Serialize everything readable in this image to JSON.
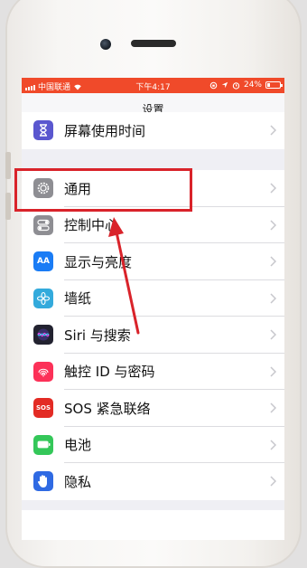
{
  "status_bar": {
    "carrier": "中国联通",
    "time": "下午4:17",
    "battery": "24%",
    "battery_fraction": 0.24
  },
  "navbar": {
    "title": "设置"
  },
  "settings": {
    "top_item": {
      "label": "屏幕使用时间",
      "icon": "hourglass-icon",
      "color": "#5a57cf"
    },
    "items": [
      {
        "label": "通用",
        "icon": "gear-icon",
        "color": "#8e8e93"
      },
      {
        "label": "控制中心",
        "icon": "toggles-icon",
        "color": "#8e8e93"
      },
      {
        "label": "显示与亮度",
        "icon": "text-size-icon",
        "color": "#1a7cf5",
        "icon_text": "AA"
      },
      {
        "label": "墙纸",
        "icon": "flower-icon",
        "color": "#33aadc"
      },
      {
        "label": "Siri 与搜索",
        "icon": "siri-icon",
        "color": "#222230"
      },
      {
        "label": "触控 ID 与密码",
        "icon": "fingerprint-icon",
        "color": "#fc3158"
      },
      {
        "label": "SOS 紧急联络",
        "icon": "sos-icon",
        "color": "#e32b24",
        "icon_text": "SOS"
      },
      {
        "label": "电池",
        "icon": "battery-icon",
        "color": "#34c759"
      },
      {
        "label": "隐私",
        "icon": "hand-icon",
        "color": "#2f6ae3"
      }
    ]
  },
  "annotation": {
    "color": "#d9232a"
  }
}
